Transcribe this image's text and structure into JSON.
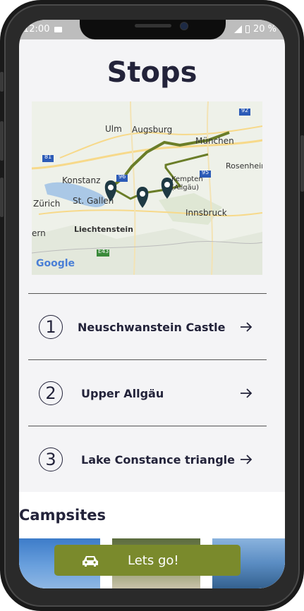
{
  "status_bar": {
    "time": "12:00",
    "battery": "20 %"
  },
  "page": {
    "title": "Stops"
  },
  "map": {
    "attribution": "Google",
    "labels": [
      "Ulm",
      "Augsburg",
      "München",
      "Konstanz",
      "Zürich",
      "St. Gallen",
      "Liechtenstein",
      "Kempten (Allgäu)",
      "Rosenheim",
      "Innsbruck",
      "ern",
      "92",
      "96",
      "95",
      "81",
      "E43"
    ]
  },
  "stops": [
    {
      "number": "1",
      "name": "Neuschwanstein Castle"
    },
    {
      "number": "2",
      "name": "Upper Allgäu"
    },
    {
      "number": "3",
      "name": "Lake Constance triangle"
    }
  ],
  "campsites": {
    "title": "Campsites"
  },
  "cta": {
    "label": "Lets go!"
  },
  "colors": {
    "accent": "#7a8a2c",
    "text": "#23233a",
    "pin": "#1f3a44"
  }
}
